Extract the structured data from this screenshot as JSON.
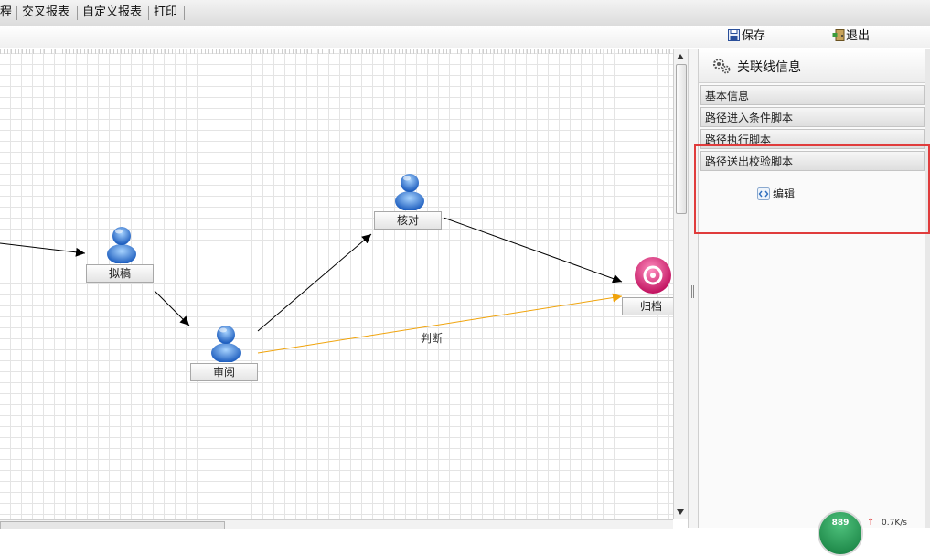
{
  "menu": {
    "items": [
      "程",
      "交叉报表",
      "自定义报表",
      "打印"
    ]
  },
  "toolbar": {
    "save_label": "保存",
    "exit_label": "退出"
  },
  "nodes": {
    "draft": "拟稿",
    "review": "审阅",
    "check": "核对",
    "archive": "归档"
  },
  "edges": {
    "judge_label": "判断",
    "judge_color": "#f0a30a"
  },
  "panel": {
    "title": "关联线信息",
    "sections": [
      "基本信息",
      "路径进入条件脚本",
      "路径执行脚本",
      "路径送出校验脚本"
    ],
    "edit_label": "编辑"
  },
  "status": {
    "badge": "889",
    "speed": "0.7K/s"
  },
  "colors": {
    "highlight": "#e03c3c",
    "archive_node": "#e0287a"
  }
}
